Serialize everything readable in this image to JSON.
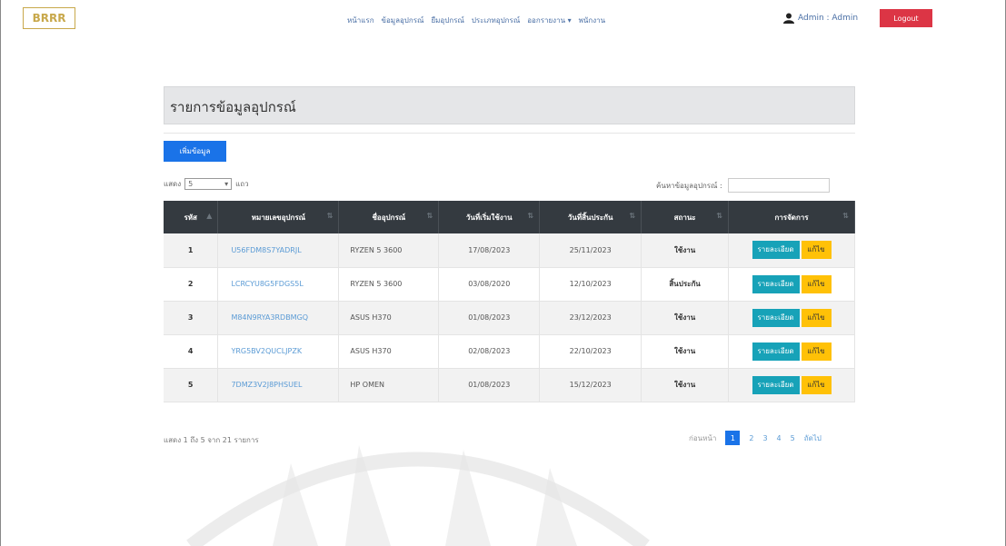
{
  "nav": {
    "logo": "BRRR",
    "links": [
      "หน้าแรก",
      "ข้อมูลอุปกรณ์",
      "ยืมอุปกรณ์",
      "ประเภทอุปกรณ์",
      "ออกรายงาน ▾",
      "พนักงาน"
    ],
    "user": "Admin : Admin",
    "logout": "Logout"
  },
  "page": {
    "title": "รายการข้อมูลอุปกรณ์",
    "add_button": "เพิ่มข้อมูล",
    "length_prefix": "แสดง",
    "length_value": "5",
    "length_suffix": "แถว",
    "search_label": "ค้นหาข้อมูลอุปกรณ์ :",
    "search_value": ""
  },
  "table": {
    "headers": [
      "รหัส",
      "หมายเลขอุปกรณ์",
      "ชื่ออุปกรณ์",
      "วันที่เริ่มใช้งาน",
      "วันที่สิ้นประกัน",
      "สถานะ",
      "การจัดการ"
    ],
    "rows": [
      {
        "id": "1",
        "serial": "U56FDM8S7YADRJL",
        "name": "RYZEN 5 3600",
        "start": "17/08/2023",
        "warranty": "25/11/2023",
        "status": "ใช้งาน"
      },
      {
        "id": "2",
        "serial": "LCRCYU8G5FDGS5L",
        "name": "RYZEN 5 3600",
        "start": "03/08/2020",
        "warranty": "12/10/2023",
        "status": "สิ้นประกัน"
      },
      {
        "id": "3",
        "serial": "M84N9RYA3RDBMGQ",
        "name": "ASUS H370",
        "start": "01/08/2023",
        "warranty": "23/12/2023",
        "status": "ใช้งาน"
      },
      {
        "id": "4",
        "serial": "YRG5BV2QUCLJPZK",
        "name": "ASUS H370",
        "start": "02/08/2023",
        "warranty": "22/10/2023",
        "status": "ใช้งาน"
      },
      {
        "id": "5",
        "serial": "7DMZ3V2J8PHSUEL",
        "name": "HP OMEN",
        "start": "01/08/2023",
        "warranty": "15/12/2023",
        "status": "ใช้งาน"
      }
    ],
    "detail_label": "รายละเอียด",
    "edit_label": "แก้ไข"
  },
  "footer": {
    "info": "แสดง 1 ถึง 5 จาก 21 รายการ",
    "prev": "ก่อนหน้า",
    "pages": [
      "1",
      "2",
      "3",
      "4",
      "5"
    ],
    "next": "ถัดไป"
  },
  "colors": {
    "primary": "#1a73e8",
    "danger": "#dc3545",
    "info": "#17a2b8",
    "warning": "#ffc107",
    "table_header": "#343a40"
  }
}
